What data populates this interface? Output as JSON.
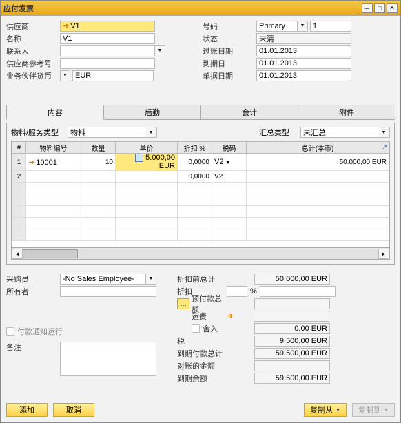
{
  "window_title": "应付发票",
  "header_left": {
    "vendor_label": "供应商",
    "vendor_value": "V1",
    "name_label": "名称",
    "name_value": "V1",
    "contact_label": "联系人",
    "contact_value": "",
    "vendor_ref_label": "供应商参考号",
    "vendor_ref_value": "",
    "bp_currency_label": "业务伙伴货币",
    "bp_currency_value": "EUR"
  },
  "header_right": {
    "number_label": "号码",
    "number_series": "Primary",
    "number_value": "1",
    "status_label": "状态",
    "status_value": "未清",
    "posting_date_label": "过账日期",
    "posting_date_value": "01.01.2013",
    "due_date_label": "到期日",
    "due_date_value": "01.01.2013",
    "doc_date_label": "单据日期",
    "doc_date_value": "01.01.2013"
  },
  "tabs": {
    "content": "内容",
    "logistics": "后勤",
    "accounting": "会计",
    "attachments": "附件"
  },
  "item_type_label": "物料/服务类型",
  "item_type_value": "物料",
  "summary_type_label": "汇总类型",
  "summary_type_value": "未汇总",
  "grid": {
    "headers": {
      "num": "#",
      "item_no": "物料编号",
      "qty": "数量",
      "price": "单价",
      "disc": "折扣 %",
      "tax": "税码",
      "total": "总计(本币)"
    },
    "rows": [
      {
        "n": "1",
        "item": "10001",
        "qty": "10",
        "price": "5.000,00 EUR",
        "disc": "0,0000",
        "tax": "V2",
        "total": "50.000,00 EUR"
      },
      {
        "n": "2",
        "item": "",
        "qty": "",
        "price": "",
        "disc": "0,0000",
        "tax": "V2",
        "total": ""
      }
    ]
  },
  "buyer_label": "采购员",
  "buyer_value": "-No Sales Employee-",
  "owner_label": "所有者",
  "payment_run_label": "付款通知运行",
  "remarks_label": "备注",
  "totals": {
    "before_disc_label": "折扣前总计",
    "before_disc_value": "50.000,00 EUR",
    "discount_label": "折扣",
    "discount_pct": "",
    "pct_symbol": "%",
    "downpay_label": "预付款总额",
    "freight_label": "运费",
    "rounding_label": "舍入",
    "rounding_value": "0,00 EUR",
    "tax_label": "税",
    "tax_value": "9.500,00 EUR",
    "payment_due_label": "到期付款总计",
    "payment_due_value": "59.500,00 EUR",
    "applied_label": "对账的金额",
    "balance_label": "到期余额",
    "balance_value": "59.500,00 EUR"
  },
  "buttons": {
    "add": "添加",
    "cancel": "取消",
    "copy_from": "复制从",
    "copy_to": "复制到"
  },
  "dots": "..."
}
